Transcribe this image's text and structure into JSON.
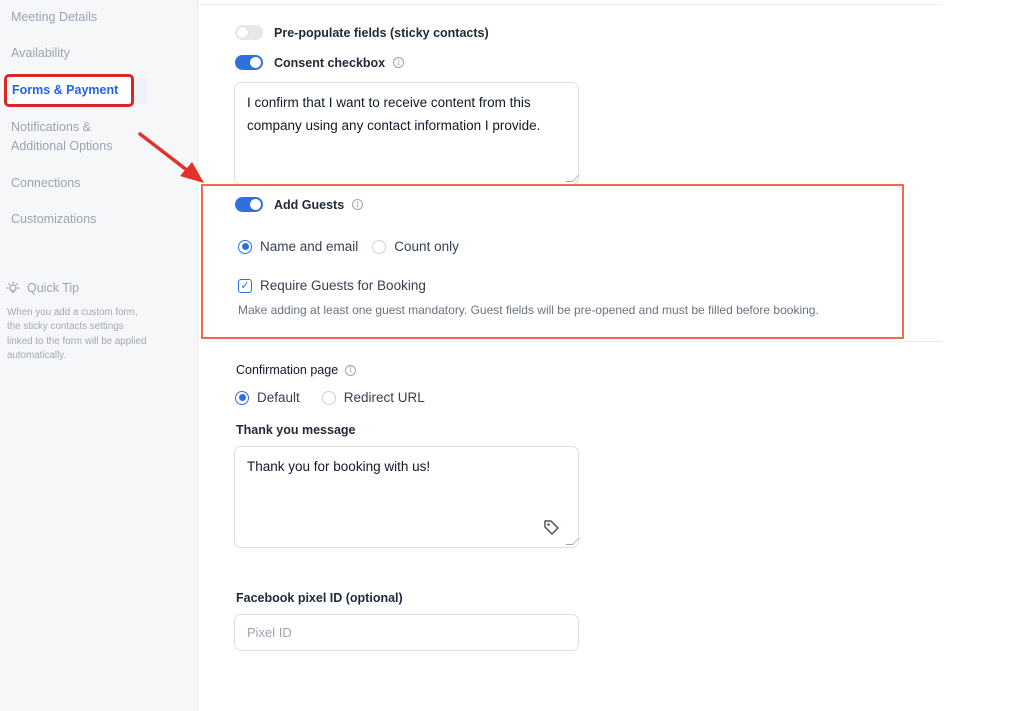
{
  "sidebar": {
    "items": [
      {
        "label": "Meeting Details"
      },
      {
        "label": "Availability"
      },
      {
        "label": "Forms & Payment"
      },
      {
        "label_line1": "Notifications &",
        "label_line2": "Additional Options"
      },
      {
        "label": "Connections"
      },
      {
        "label": "Customizations"
      }
    ],
    "quick_tip": {
      "title": "Quick Tip",
      "icon": "lightbulb-icon",
      "text": "When you add a custom form, the sticky contacts settings linked to the form will be applied automatically."
    }
  },
  "form": {
    "prepopulate": {
      "label": "Pre-populate fields (sticky contacts)",
      "enabled": false
    },
    "consent": {
      "label": "Consent checkbox",
      "enabled": true,
      "text": "I confirm that I want to receive content from this company using any contact information I provide."
    },
    "add_guests": {
      "label": "Add Guests",
      "enabled": true,
      "options": [
        {
          "label": "Name and email",
          "selected": true
        },
        {
          "label": "Count only",
          "selected": false
        }
      ],
      "require": {
        "label": "Require Guests for Booking",
        "checked": true,
        "help": "Make adding at least one guest mandatory. Guest fields will be pre-opened and must be filled before booking."
      }
    },
    "confirmation": {
      "label": "Confirmation page",
      "options": [
        {
          "label": "Default",
          "selected": true
        },
        {
          "label": "Redirect URL",
          "selected": false
        }
      ]
    },
    "thank_you": {
      "label": "Thank you message",
      "value": "Thank you for booking with us!"
    },
    "facebook_pixel": {
      "label": "Facebook pixel ID (optional)",
      "placeholder": "Pixel ID"
    }
  },
  "colors": {
    "accent": "#2f6fe0",
    "highlight_red": "#e02424",
    "highlight_orange": "#ef6b4f"
  }
}
